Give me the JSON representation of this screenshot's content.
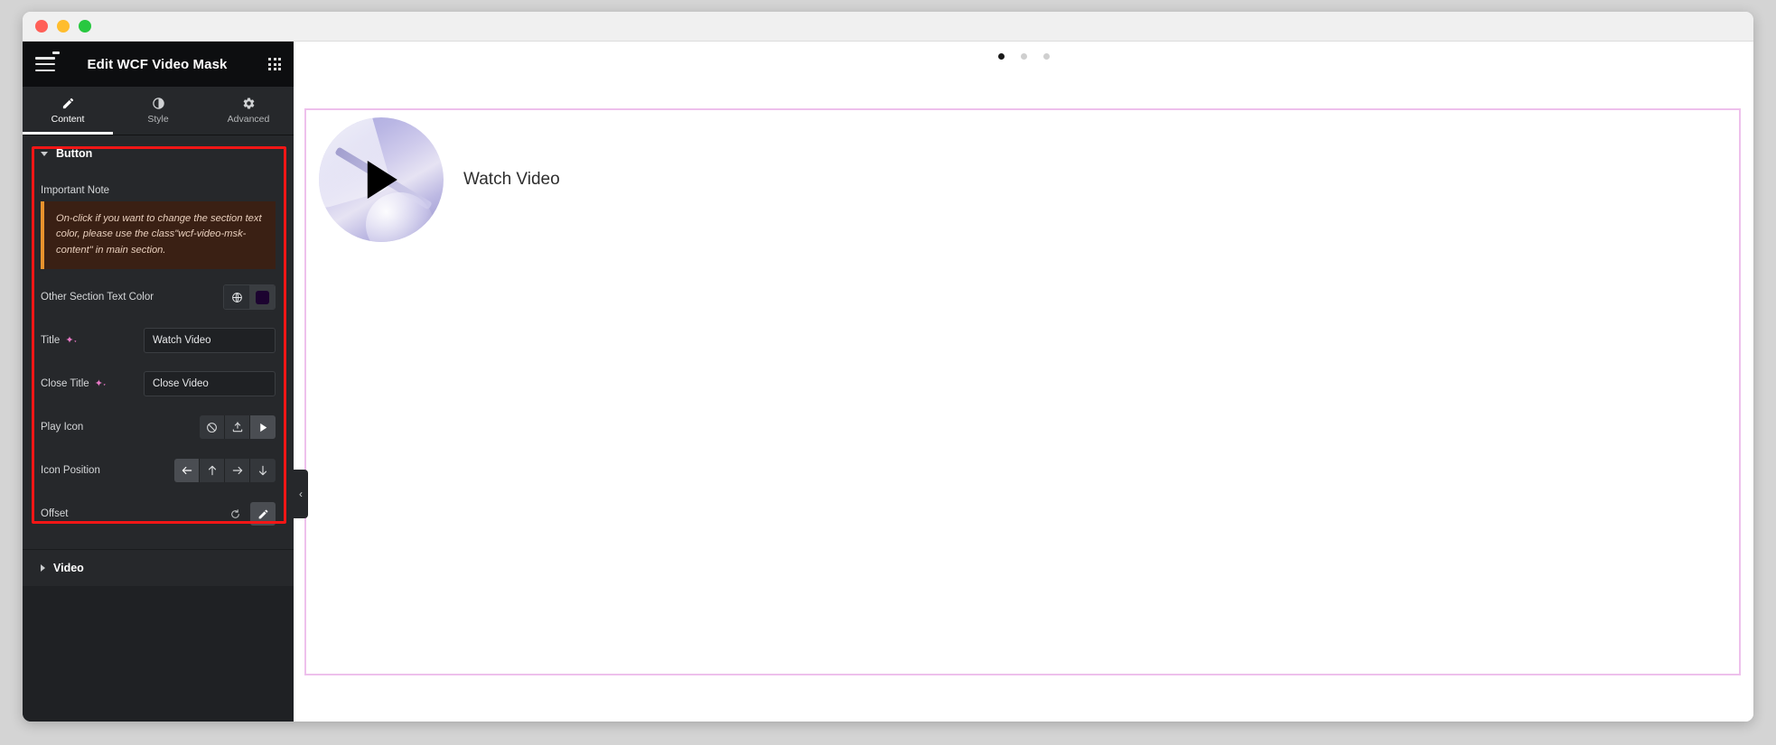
{
  "window": {
    "traffic_lights": [
      "close",
      "minimize",
      "maximize"
    ]
  },
  "panel": {
    "title": "Edit WCF Video Mask",
    "menu_icon": "hamburger-icon",
    "apps_icon": "grid-apps-icon",
    "notification_dot_color": "#7c3aed",
    "tabs": [
      {
        "label": "Content",
        "icon": "pencil-icon",
        "active": true
      },
      {
        "label": "Style",
        "icon": "contrast-icon",
        "active": false
      },
      {
        "label": "Advanced",
        "icon": "gear-icon",
        "active": false
      }
    ],
    "sections": [
      {
        "label": "Button",
        "expanded": true
      },
      {
        "label": "Video",
        "expanded": false
      }
    ],
    "highlight_color": "#f41616"
  },
  "button_section": {
    "note_label": "Important Note",
    "note_text": "On-click if you want to change the section text color, please use the class\"wcf-video-msk-content\" in main section.",
    "note_accent": "#e8922d",
    "note_bg": "#3a2014",
    "fields": {
      "other_section_text_color": {
        "label": "Other Section Text Color",
        "globe_icon": "globe-icon",
        "swatch_color": "#1c0330"
      },
      "title": {
        "label": "Title",
        "ai_icon": "sparkle-ai-icon",
        "value": "Watch Video",
        "placeholder": "Watch Video"
      },
      "close_title": {
        "label": "Close Title",
        "ai_icon": "sparkle-ai-icon",
        "value": "Close Video",
        "placeholder": "Close Video"
      },
      "play_icon": {
        "label": "Play Icon",
        "options": [
          {
            "name": "none-icon",
            "selected": false
          },
          {
            "name": "upload-icon",
            "selected": false
          },
          {
            "name": "play-triangle-icon",
            "selected": true
          }
        ]
      },
      "icon_position": {
        "label": "Icon Position",
        "options": [
          {
            "name": "arrow-left-icon",
            "selected": true
          },
          {
            "name": "arrow-up-icon",
            "selected": false
          },
          {
            "name": "arrow-right-icon",
            "selected": false
          },
          {
            "name": "arrow-down-icon",
            "selected": false
          }
        ]
      },
      "offset": {
        "label": "Offset",
        "reset_icon": "reset-icon",
        "edit_icon": "pencil-edit-icon"
      }
    }
  },
  "canvas": {
    "pagination_dots": [
      {
        "active": true
      },
      {
        "active": false
      },
      {
        "active": false
      }
    ],
    "section_border_color": "#eec0ec",
    "widget": {
      "play_icon": "play-triangle-icon",
      "title": "Watch Video"
    },
    "collapse_handle": "‹"
  }
}
